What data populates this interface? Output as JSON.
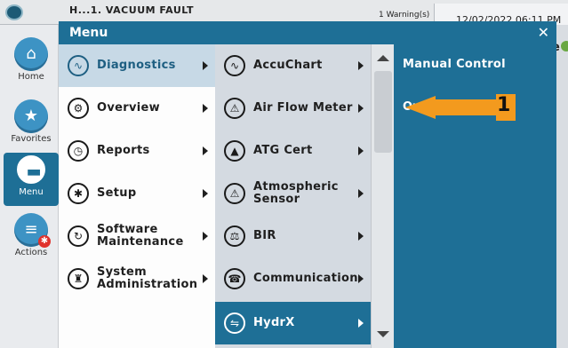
{
  "topbar": {
    "title": "H...1. VACUUM FAULT",
    "warnings": "1 Warning(s)",
    "datetime": "12/02/2022 06:11 PM"
  },
  "sidebar": [
    {
      "label": "Home",
      "icon": "home-icon"
    },
    {
      "label": "Favorites",
      "icon": "star-icon"
    },
    {
      "label": "Menu",
      "icon": "menu-icon",
      "active": true
    },
    {
      "label": "Actions",
      "icon": "actions-icon"
    }
  ],
  "edge_letter": "e",
  "menu": {
    "title": "Menu",
    "close": "✕",
    "col1": [
      {
        "label": "Diagnostics",
        "icon": "diagnostics-icon",
        "glyph": "∿",
        "selected": true
      },
      {
        "label": "Overview",
        "icon": "overview-icon",
        "glyph": "⚙"
      },
      {
        "label": "Reports",
        "icon": "reports-icon",
        "glyph": "◷"
      },
      {
        "label": "Setup",
        "icon": "setup-icon",
        "glyph": "✱"
      },
      {
        "label": "Software\nMaintenance",
        "icon": "software-icon",
        "glyph": "↻"
      },
      {
        "label": "System\nAdministration",
        "icon": "system-icon",
        "glyph": "♜"
      }
    ],
    "col2": [
      {
        "label": "AccuChart",
        "icon": "accuchart-icon",
        "glyph": "∿"
      },
      {
        "label": "Air Flow Meter",
        "icon": "airflow-icon",
        "glyph": "⚠"
      },
      {
        "label": "ATG Cert",
        "icon": "atg-icon",
        "glyph": "▲"
      },
      {
        "label": "Atmospheric\nSensor",
        "icon": "atmospheric-icon",
        "glyph": "⚠"
      },
      {
        "label": "BIR",
        "icon": "bir-icon",
        "glyph": "⚖"
      },
      {
        "label": "Communication",
        "icon": "communication-icon",
        "glyph": "☎"
      },
      {
        "label": "HydrX",
        "icon": "hydrx-icon",
        "glyph": "⇋",
        "selected": true
      }
    ],
    "col3": [
      "Manual Control",
      "Overview"
    ]
  },
  "callout": {
    "number": "1",
    "color": "#f39a1e"
  }
}
